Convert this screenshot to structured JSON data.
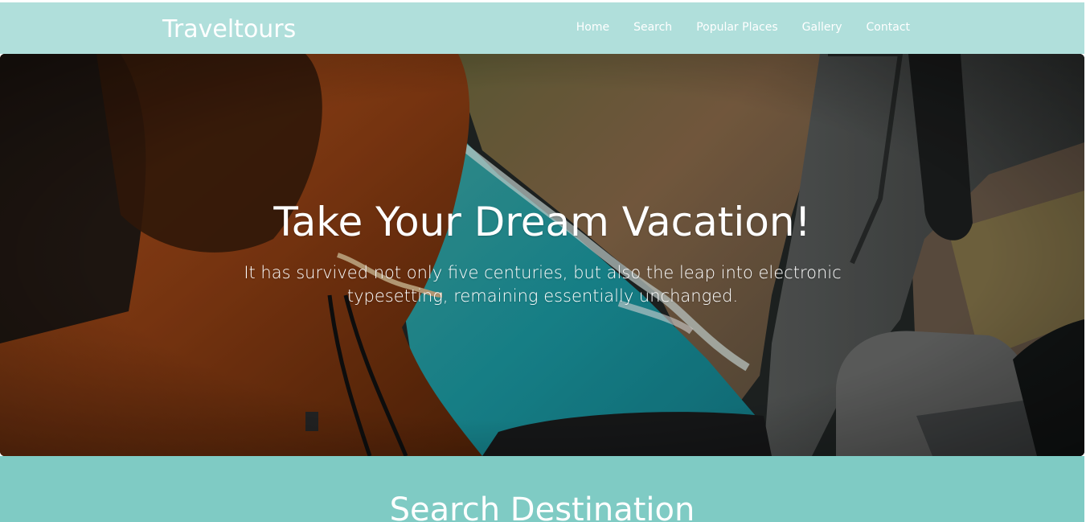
{
  "navbar": {
    "brand": "Traveltours",
    "links": [
      "Home",
      "Search",
      "Popular Places",
      "Gallery",
      "Contact"
    ],
    "background": "#b0dfdb"
  },
  "hero": {
    "title": "Take Your Dream Vacation!",
    "subtitle": "It has survived not only five centuries, but also the leap into electronic typesetting, remaining essentially unchanged."
  },
  "search_section": {
    "title": "Search Destination",
    "background": "#7fcbc4"
  }
}
